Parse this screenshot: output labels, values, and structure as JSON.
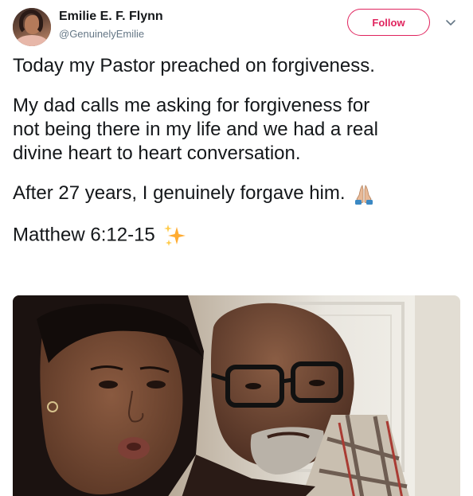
{
  "user": {
    "name": "Emilie E. F. Flynn",
    "handle": "@GenuinelyEmilie"
  },
  "actions": {
    "follow_label": "Follow"
  },
  "tweet": {
    "paragraphs": [
      "Today my Pastor preached on forgiveness.",
      "My dad calls me asking for forgiveness for",
      "not being there in my life and we had a real",
      "divine heart to heart conversation.",
      "After 27 years, I genuinely forgave him.",
      "Matthew 6:12-15"
    ]
  },
  "icons": {
    "pray": "folded-hands-icon",
    "sparkles": "sparkles-icon",
    "caret": "chevron-down-icon"
  },
  "colors": {
    "follow_accent": "#e0245e",
    "text": "#14171a",
    "secondary_text": "#657786"
  }
}
